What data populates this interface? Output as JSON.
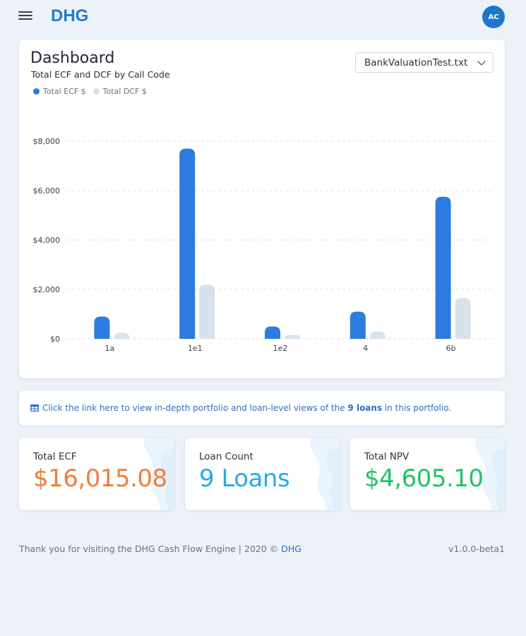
{
  "header": {
    "logo_text": "DHG",
    "avatar_initials": "AC"
  },
  "dashboard": {
    "title": "Dashboard",
    "subtitle": "Total ECF and DCF by Call Code",
    "file_select_value": "BankValuationTest.txt"
  },
  "chart_data": {
    "type": "bar",
    "title": "Total ECF and DCF by Call Code",
    "categories": [
      "1a",
      "1e1",
      "1e2",
      "4",
      "6b"
    ],
    "series": [
      {
        "name": "Total ECF $",
        "color": "#2d7be0",
        "values": [
          900,
          7700,
          500,
          1100,
          5750
        ]
      },
      {
        "name": "Total DCF $",
        "color": "#d8e2ee",
        "values": [
          250,
          2200,
          150,
          300,
          1650
        ]
      }
    ],
    "y_ticks": [
      "$0",
      "$2,000",
      "$4,000",
      "$6,000",
      "$8,000"
    ],
    "ylim": [
      0,
      8000
    ],
    "grid": true,
    "legend_position": "top-left"
  },
  "info": {
    "prefix": "Click the link here to view in-depth portfolio and loan-level views of the ",
    "loans": "9 loans",
    "suffix": " in this portfolio."
  },
  "stats": [
    {
      "label": "Total ECF",
      "value": "$16,015.08",
      "color": "#f07e3a"
    },
    {
      "label": "Loan Count",
      "value": "9 Loans",
      "color": "#2aa8e8"
    },
    {
      "label": "Total NPV",
      "value": "$4,605.10",
      "color": "#1fc466"
    }
  ],
  "footer": {
    "text": "Thank you for visiting the DHG Cash Flow Engine | 2020 © ",
    "link": "DHG",
    "version": "v1.0.0-beta1"
  }
}
